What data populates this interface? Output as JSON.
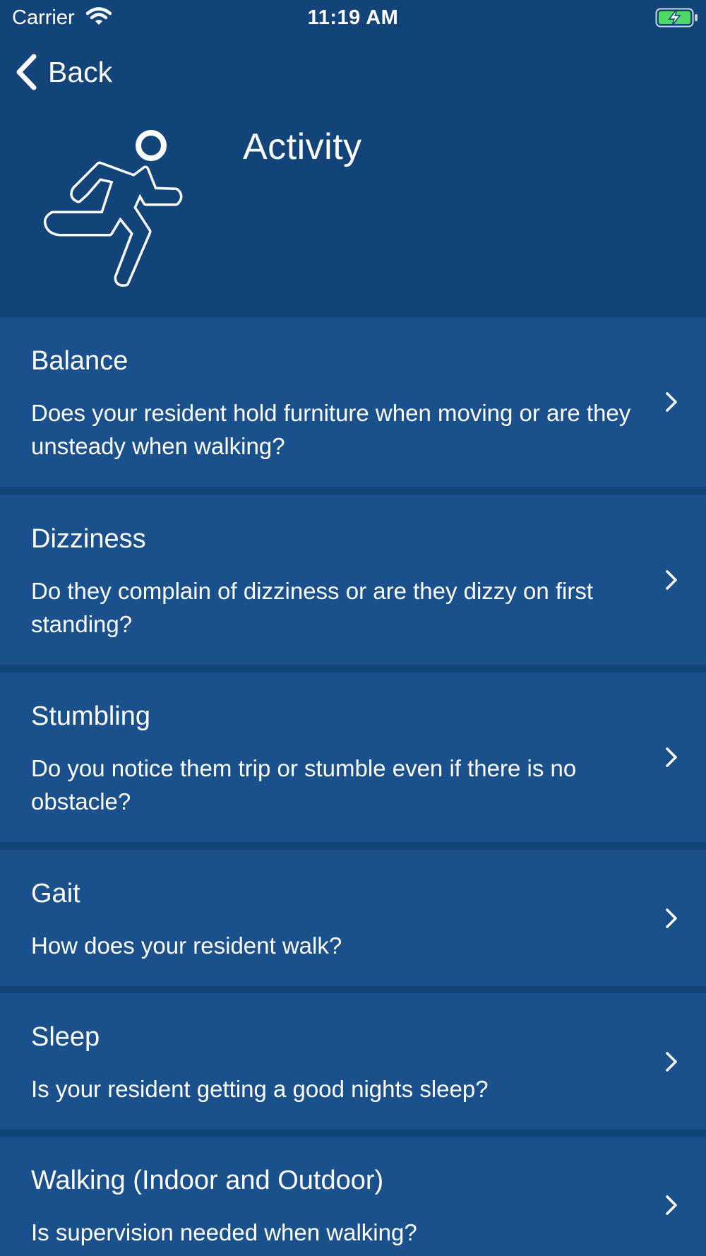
{
  "status_bar": {
    "carrier": "Carrier",
    "time": "11:19 AM"
  },
  "nav": {
    "back_label": "Back"
  },
  "header": {
    "title": "Activity",
    "icon": "running-person-icon"
  },
  "items": [
    {
      "title": "Balance",
      "description": "Does your resident hold furniture when moving or are they unsteady when walking?"
    },
    {
      "title": "Dizziness",
      "description": "Do they complain of dizziness or are they dizzy on first standing?"
    },
    {
      "title": "Stumbling",
      "description": "Do you notice them trip or stumble even if there is no obstacle?"
    },
    {
      "title": "Gait",
      "description": "How does your resident walk?"
    },
    {
      "title": "Sleep",
      "description": "Is your resident getting a good nights sleep?"
    },
    {
      "title": "Walking (Indoor and Outdoor)",
      "description": "Is supervision needed when walking?"
    }
  ],
  "colors": {
    "background": "#12447a",
    "row": "#1a518d",
    "battery_fill": "#4cd964"
  }
}
